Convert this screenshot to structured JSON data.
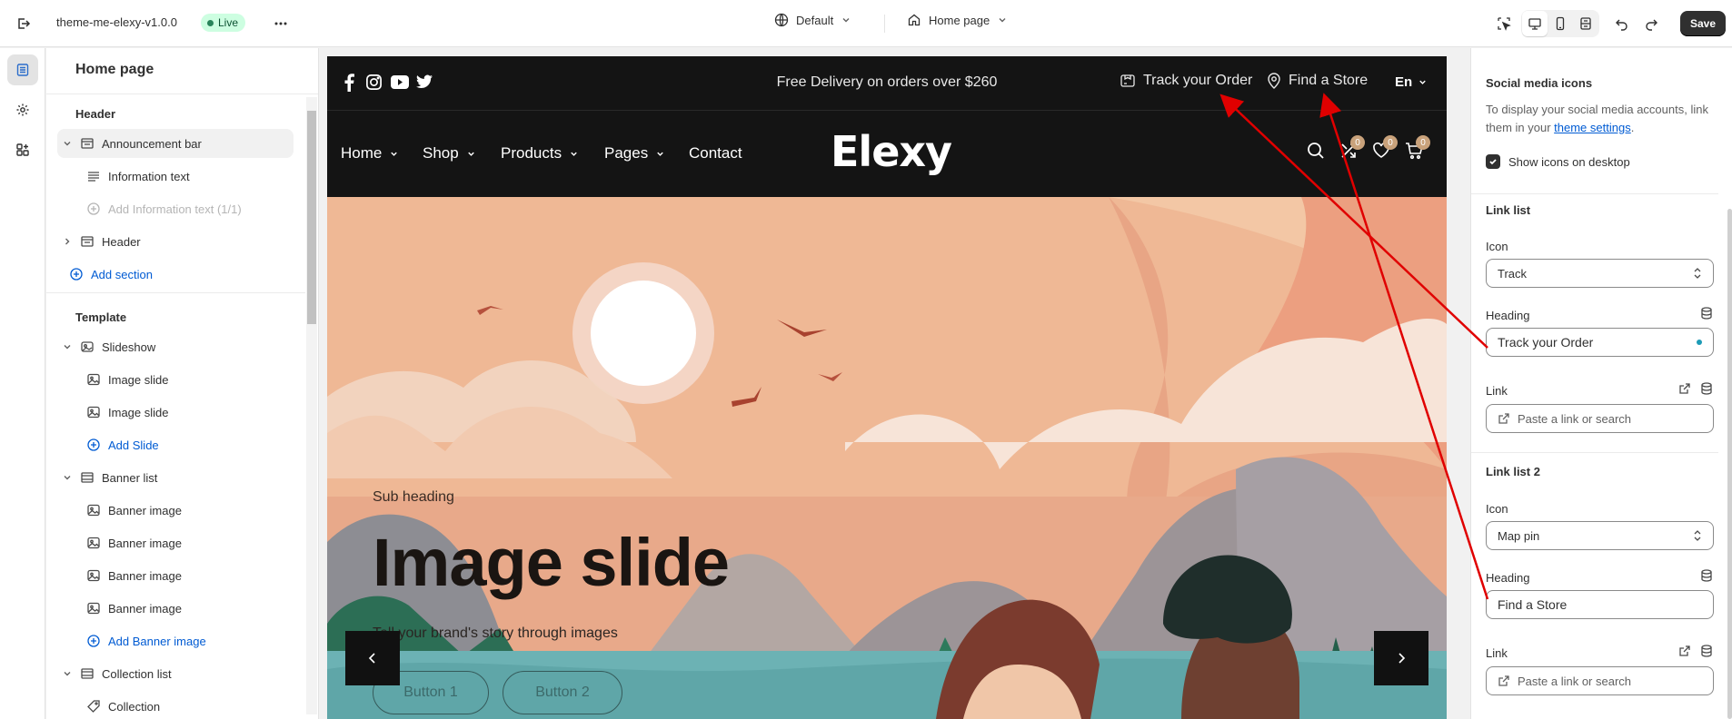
{
  "topbar": {
    "theme_name": "theme-me-elexy-v1.0.0",
    "live_label": "Live",
    "theme_select": "Default",
    "page_select": "Home page",
    "save_label": "Save"
  },
  "sidebar": {
    "title": "Home page",
    "header_group": "Header",
    "template_group": "Template",
    "items": {
      "announcement_bar": "Announcement bar",
      "information_text": "Information text",
      "add_information_text": "Add Information text (1/1)",
      "header": "Header",
      "add_section": "Add section",
      "slideshow": "Slideshow",
      "image_slide_1": "Image slide",
      "image_slide_2": "Image slide",
      "add_slide": "Add Slide",
      "banner_list": "Banner list",
      "banner_image_1": "Banner image",
      "banner_image_2": "Banner image",
      "banner_image_3": "Banner image",
      "banner_image_4": "Banner image",
      "add_banner_image": "Add Banner image",
      "collection_list": "Collection list",
      "collection": "Collection"
    }
  },
  "preview": {
    "announcement": "Free Delivery on orders over $260",
    "track_link": "Track your Order",
    "store_link": "Find a Store",
    "language": "En",
    "nav": [
      "Home",
      "Shop",
      "Products",
      "Pages",
      "Contact"
    ],
    "logo": "Elexy",
    "counts": {
      "compare": "0",
      "wishlist": "0",
      "cart": "0"
    },
    "hero": {
      "sub_heading": "Sub heading",
      "title": "Image slide",
      "description": "Tell your brand's story through images",
      "button_1": "Button 1",
      "button_2": "Button 2"
    }
  },
  "settings": {
    "social_heading": "Social media icons",
    "social_help_prefix": "To display your social media accounts, link them in your ",
    "social_help_link": "theme settings",
    "social_help_suffix": ".",
    "show_icons_label": "Show icons on desktop",
    "link_list_heading": "Link list",
    "icon_label": "Icon",
    "icon_value": "Track",
    "heading_label": "Heading",
    "heading_value": "Track your Order",
    "link_label": "Link",
    "link_placeholder": "Paste a link or search",
    "link_list2_heading": "Link list 2",
    "icon2_label": "Icon",
    "icon2_value": "Map pin",
    "heading2_label": "Heading",
    "heading2_value": "Find a Store",
    "link2_label": "Link",
    "link2_placeholder": "Paste a link or search"
  },
  "colors": {
    "accent_blue": "#005bd3",
    "annotation_red": "#e00000",
    "preview_dark": "#141414",
    "hero_peach": "#f0b995"
  }
}
